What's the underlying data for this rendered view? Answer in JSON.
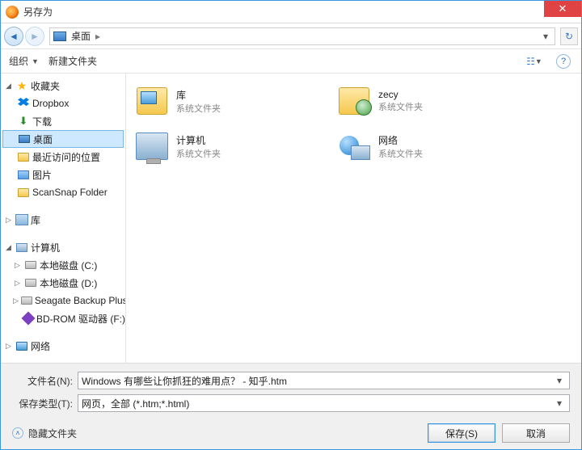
{
  "title": "另存为",
  "breadcrumb": {
    "location": "桌面"
  },
  "toolbar": {
    "organize": "组织",
    "new_folder": "新建文件夹"
  },
  "sidebar": {
    "favorites": "收藏夹",
    "fav_items": [
      "Dropbox",
      "下载",
      "桌面",
      "最近访问的位置",
      "图片",
      "ScanSnap Folder"
    ],
    "libraries": "库",
    "computer": "计算机",
    "drives": [
      "本地磁盘 (C:)",
      "本地磁盘 (D:)",
      "Seagate Backup Plus",
      "BD-ROM 驱动器 (F:)"
    ],
    "network": "网络"
  },
  "content": {
    "sys_folder": "系统文件夹",
    "items": [
      "库",
      "zecy",
      "计算机",
      "网络"
    ]
  },
  "form": {
    "filename_label": "文件名(N):",
    "filename_value": "Windows 有哪些让你抓狂的难用点？ - 知乎.htm",
    "type_label": "保存类型(T):",
    "type_value": "网页，全部 (*.htm;*.html)"
  },
  "footer": {
    "hidden": "隐藏文件夹",
    "save": "保存(S)",
    "cancel": "取消"
  }
}
